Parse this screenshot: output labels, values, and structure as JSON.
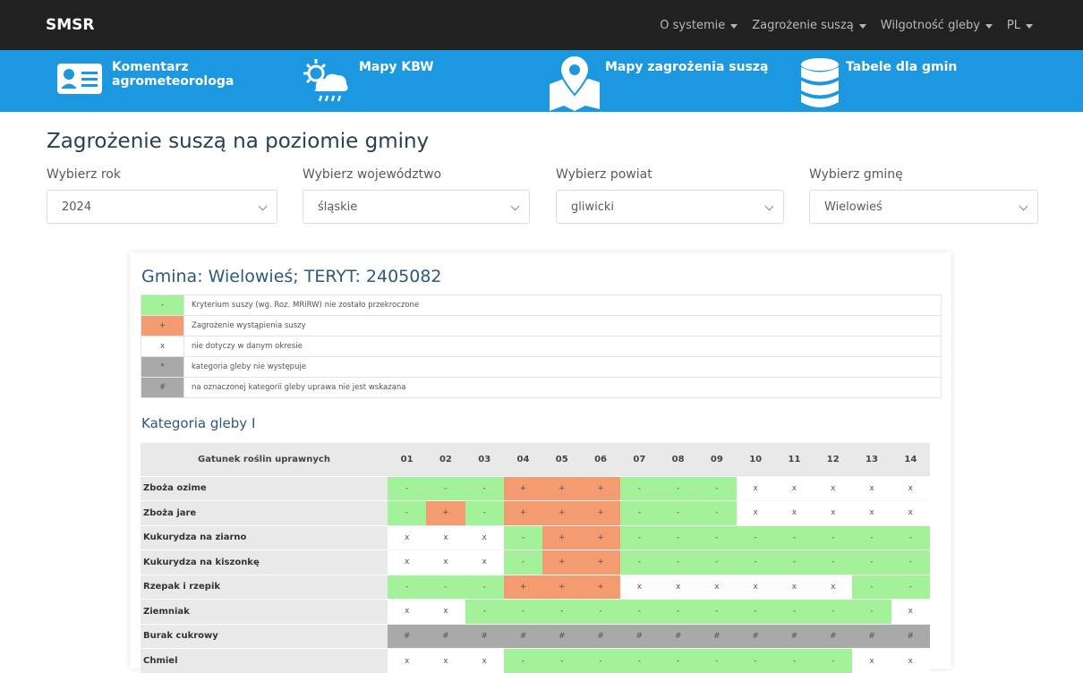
{
  "brand": "SMSR",
  "topmenu": [
    {
      "label": "O systemie"
    },
    {
      "label": "Zagrożenie suszą"
    },
    {
      "label": "Wilgotność gleby"
    },
    {
      "label": "PL"
    }
  ],
  "bluebar": {
    "comment": "Komentarz agrometeorologa",
    "comment_line1": "Komentarz",
    "comment_line2": "agrometeorologa",
    "kbw": "Mapy KBW",
    "drought_maps": "Mapy zagrożenia suszą",
    "tables": "Tabele dla gmin"
  },
  "page_title": "Zagrożenie suszą na poziomie gminy",
  "selectors": {
    "year_label": "Wybierz rok",
    "year_value": "2024",
    "voiv_label": "Wybierz województwo",
    "voiv_value": "śląskie",
    "county_label": "Wybierz powiat",
    "county_value": "gliwicki",
    "gmina_label": "Wybierz gminę",
    "gmina_value": "Wielowieś"
  },
  "card_title": "Gmina: Wielowieś; TERYT: 2405082",
  "legend": [
    {
      "symbol": "-",
      "text": "Kryterium suszy (wg. Roz. MRiRW) nie zostało przekroczone",
      "color": "#a3f29a"
    },
    {
      "symbol": "+",
      "text": "Zagrożenie wystąpienia suszy",
      "color": "#f59b71"
    },
    {
      "symbol": "x",
      "text": "nie dotyczy w danym okresie",
      "color": "#ffffff"
    },
    {
      "symbol": "*",
      "text": "kategoria gleby nie występuje",
      "color": "#a9a9a9"
    },
    {
      "symbol": "#",
      "text": "na oznaczonej kategorii gleby uprawa nie jest wskazana",
      "color": "#a9a9a9"
    }
  ],
  "category_title": "Kategoria gleby I",
  "table": {
    "crop_header": "Gatunek roślin uprawnych",
    "periods": [
      "01",
      "02",
      "03",
      "04",
      "05",
      "06",
      "07",
      "08",
      "09",
      "10",
      "11",
      "12",
      "13",
      "14"
    ],
    "rows": [
      {
        "crop": "Zboża ozime",
        "cells": [
          "-",
          "-",
          "-",
          "+",
          "+",
          "+",
          "-",
          "-",
          "-",
          "x",
          "x",
          "x",
          "x",
          "x"
        ]
      },
      {
        "crop": "Zboża jare",
        "cells": [
          "-",
          "+",
          "-",
          "+",
          "+",
          "+",
          "-",
          "-",
          "-",
          "x",
          "x",
          "x",
          "x",
          "x"
        ]
      },
      {
        "crop": "Kukurydza na ziarno",
        "cells": [
          "x",
          "x",
          "x",
          "-",
          "+",
          "+",
          "-",
          "-",
          "-",
          "-",
          "-",
          "-",
          "-",
          "-"
        ]
      },
      {
        "crop": "Kukurydza na kiszonkę",
        "cells": [
          "x",
          "x",
          "x",
          "-",
          "+",
          "+",
          "-",
          "-",
          "-",
          "-",
          "-",
          "-",
          "-",
          "-"
        ]
      },
      {
        "crop": "Rzepak i rzepik",
        "cells": [
          "-",
          "-",
          "-",
          "+",
          "+",
          "+",
          "x",
          "x",
          "x",
          "x",
          "x",
          "x",
          "-",
          "-"
        ]
      },
      {
        "crop": "Ziemniak",
        "cells": [
          "x",
          "x",
          "-",
          "-",
          "-",
          "-",
          "-",
          "-",
          "-",
          "-",
          "-",
          "-",
          "-",
          "x"
        ]
      },
      {
        "crop": "Burak cukrowy",
        "cells": [
          "#",
          "#",
          "#",
          "#",
          "#",
          "#",
          "#",
          "#",
          "#",
          "#",
          "#",
          "#",
          "#",
          "#"
        ]
      },
      {
        "crop": "Chmiel",
        "cells": [
          "x",
          "x",
          "x",
          "-",
          "-",
          "-",
          "-",
          "-",
          "-",
          "-",
          "-",
          "-",
          "x",
          "x"
        ]
      }
    ]
  }
}
